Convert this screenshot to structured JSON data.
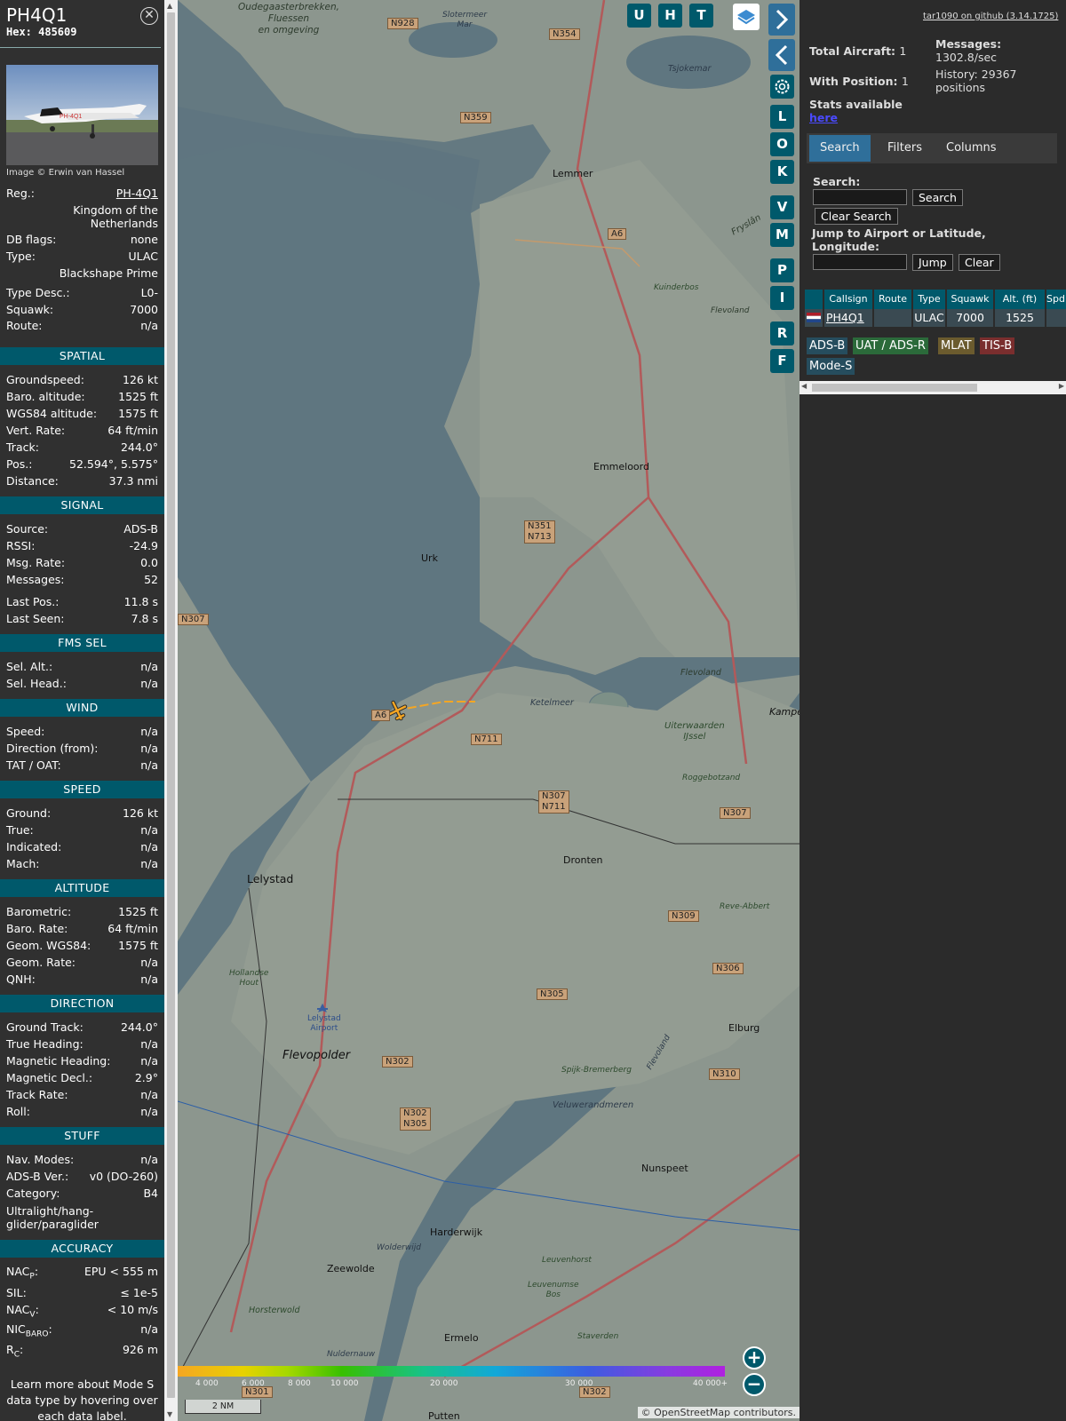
{
  "info": {
    "callsign": "PH4Q1",
    "hex": "Hex: 485609",
    "photo_credit": "Image © Erwin van Hassel",
    "reg_label": "Reg.:",
    "reg": "PH-4Q1",
    "country_1": "Kingdom of the",
    "country_2": "Netherlands",
    "dbflags_label": "DB flags:",
    "dbflags": "none",
    "type_label": "Type:",
    "type": "ULAC",
    "type_name": "Blackshape Prime",
    "typedesc_label": "Type Desc.:",
    "typedesc": "L0-",
    "squawk_label": "Squawk:",
    "squawk": "7000",
    "route_label": "Route:",
    "route": "n/a",
    "spatial": "SPATIAL",
    "gs_label": "Groundspeed:",
    "gs": "126 kt",
    "baro_label": "Baro. altitude:",
    "baro": "1525 ft",
    "wgs_label": "WGS84 altitude:",
    "wgs": "1575 ft",
    "vr_label": "Vert. Rate:",
    "vr": "64 ft/min",
    "track_label": "Track:",
    "track": "244.0°",
    "pos_label": "Pos.:",
    "pos": "52.594°, 5.575°",
    "dist_label": "Distance:",
    "dist": "37.3 nmi",
    "signal": "SIGNAL",
    "src_label": "Source:",
    "src": "ADS-B",
    "rssi_label": "RSSI:",
    "rssi": "-24.9",
    "msgrate_label": "Msg. Rate:",
    "msgrate": "0.0",
    "msgs_label": "Messages:",
    "msgs": "52",
    "lastpos_label": "Last Pos.:",
    "lastpos": "11.8 s",
    "lastseen_label": "Last Seen:",
    "lastseen": "7.8 s",
    "fms": "FMS SEL",
    "selalt_label": "Sel. Alt.:",
    "selalt": "n/a",
    "selhead_label": "Sel. Head.:",
    "selhead": "n/a",
    "wind": "WIND",
    "wspeed_label": "Speed:",
    "wspeed": "n/a",
    "wdir_label": "Direction (from):",
    "wdir": "n/a",
    "tat_label": "TAT / OAT:",
    "tat": "n/a",
    "speed": "SPEED",
    "ground_label": "Ground:",
    "ground": "126 kt",
    "true_label": "True:",
    "true": "n/a",
    "ind_label": "Indicated:",
    "ind": "n/a",
    "mach_label": "Mach:",
    "mach": "n/a",
    "altitude": "ALTITUDE",
    "balt_label": "Barometric:",
    "balt": "1525 ft",
    "brate_label": "Baro. Rate:",
    "brate": "64 ft/min",
    "galt_label": "Geom. WGS84:",
    "galt": "1575 ft",
    "grate_label": "Geom. Rate:",
    "grate": "n/a",
    "qnh_label": "QNH:",
    "qnh": "n/a",
    "direction": "DIRECTION",
    "gtrack_label": "Ground Track:",
    "gtrack": "244.0°",
    "thead_label": "True Heading:",
    "thead": "n/a",
    "mhead_label": "Magnetic Heading:",
    "mhead": "n/a",
    "mdecl_label": "Magnetic Decl.:",
    "mdecl": "2.9°",
    "trate_label": "Track Rate:",
    "trate": "n/a",
    "roll_label": "Roll:",
    "roll": "n/a",
    "stuff": "STUFF",
    "navmodes_label": "Nav. Modes:",
    "navmodes": "n/a",
    "adsbver_label": "ADS-B Ver.:",
    "adsbver": "v0 (DO-260)",
    "cat_label": "Category:",
    "cat": "B4",
    "cat_desc_1": "Ultralight/hang-",
    "cat_desc_2": "glider/paraglider",
    "accuracy": "ACCURACY",
    "nacp_label": "NAC",
    "nacp_sub": "P",
    "nacp": "EPU < 555 m",
    "sil_label": "SIL:",
    "sil": "≤ 1e-5",
    "nacv_label": "NAC",
    "nacv_sub": "V",
    "nacv": "< 10 m/s",
    "nic_label": "NIC",
    "nic_sub": "BARO",
    "nic": "n/a",
    "rc_label": "R",
    "rc_sub": "C",
    "rc": "926 m",
    "learn_1": "Learn more about Mode S",
    "learn_2": "data type by hovering over",
    "learn_3": "each data label."
  },
  "map": {
    "top_buttons": [
      "U",
      "H",
      "T"
    ],
    "side_buttons": [
      "L",
      "O",
      "K",
      "V",
      "M",
      "P",
      "I",
      "R",
      "F"
    ],
    "scale": "2 NM",
    "attribution": "© OpenStreetMap contributors.",
    "legend_ticks": [
      "4 000",
      "6 000",
      "8 000",
      "10 000",
      "20 000",
      "30 000",
      "40 000+"
    ],
    "places": {
      "lemmer": "Lemmer",
      "emmeloord": "Emmeloord",
      "urk": "Urk",
      "lelystad": "Lelystad",
      "dronten": "Dronten",
      "flevopolder": "Flevopolder",
      "harderwijk": "Harderwijk",
      "zeewolde": "Zeewolde",
      "elburg": "Elburg",
      "nunspeet": "Nunspeet",
      "ermelo": "Ermelo",
      "ketelmeer": "Ketelmeer",
      "veluwerandmeren": "Veluwerandmeren",
      "kampen": "Kampe",
      "oudega": "Oudegaasterbrekken,",
      "oudega2": "Fluessen",
      "oudega3": "en omgeving",
      "lelyairport": "Lelystad",
      "lelyairport2": "Airport",
      "uiterwaarden": "Uiterwaarden",
      "ijssel": "IJssel",
      "roggebotzand": "Roggebotzand",
      "putten": "Putten",
      "staverden": "Staverden",
      "leuvenhorst": "Leuvenhorst",
      "horsterwold": "Horsterwold",
      "revebeer": "Reve-Abbert",
      "tjeukemeer": "Tsjokemar",
      "flevoland": "Flevoland",
      "kuinderbos": "Kuinderbos",
      "spijk": "Spijk-Bremerberg",
      "hollandse": "Hollandse",
      "hout": "Hout",
      "wolderwijd": "Wolderwijd",
      "nuldernauw": "Nuldernauw",
      "leuvenumse": "Leuvenumse",
      "bos": "Bos",
      "fryslan": "Fryslân",
      "sloten": "Slotermeer",
      "sloten2": "Mar"
    },
    "roads": {
      "n928": "N928",
      "n354": "N354",
      "n359": "N359",
      "a6": "A6",
      "n351": "N351",
      "n713": "N713",
      "n307a": "N307",
      "n711": "N711",
      "n307b": "N307",
      "n711b": "N711",
      "n307c": "N307",
      "n309": "N309",
      "n306": "N306",
      "n305": "N305",
      "n302": "N302",
      "n310": "N310",
      "n302b": "N302",
      "n305b": "N305",
      "n301": "N301",
      "n302c": "N302",
      "a6b": "A6"
    },
    "aircraft_color": "#f5a623"
  },
  "panel": {
    "github": "tar1090 on github (3.14.1725)",
    "total_label": "Total Aircraft:",
    "total": "1",
    "withpos_label": "With Position:",
    "withpos": "1",
    "stats_label": "Stats available",
    "stats_link": "here",
    "msgs_label": "Messages:",
    "msgs": "1302.8/sec",
    "hist_label": "History: 29367",
    "hist_2": "positions",
    "tabs": [
      "Search",
      "Filters",
      "Columns"
    ],
    "search_label": "Search:",
    "search_btn": "Search",
    "clear_search": "Clear Search",
    "jump_label_1": "Jump to Airport or Latitude,",
    "jump_label_2": "Longitude:",
    "jump_btn": "Jump",
    "clear_btn": "Clear",
    "columns": [
      "Callsign",
      "Route",
      "Type",
      "Squawk",
      "Alt. (ft)",
      "Spd."
    ],
    "row": {
      "callsign": "PH4Q1",
      "route": "",
      "type": "ULAC",
      "squawk": "7000",
      "alt": "1525",
      "spd": ""
    },
    "badges": [
      "ADS-B",
      "UAT / ADS-R",
      "MLAT",
      "TIS-B",
      "Mode-S"
    ]
  }
}
